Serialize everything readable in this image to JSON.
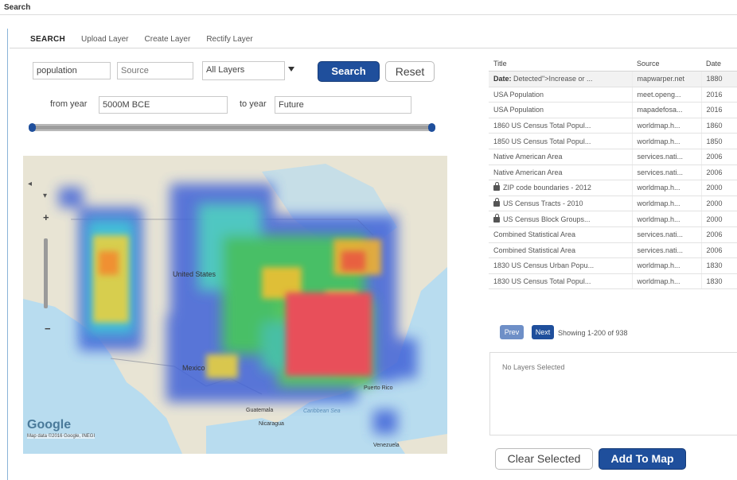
{
  "window": {
    "title": "Search"
  },
  "tabs": [
    {
      "label": "SEARCH",
      "active": true
    },
    {
      "label": "Upload Layer",
      "active": false
    },
    {
      "label": "Create Layer",
      "active": false
    },
    {
      "label": "Rectify Layer",
      "active": false
    }
  ],
  "search": {
    "query_value": "population",
    "source_placeholder": "Source",
    "layers_selected": "All Layers",
    "search_label": "Search",
    "reset_label": "Reset",
    "from_year_label": "from year",
    "from_year_value": "5000M BCE",
    "to_year_label": "to year",
    "to_year_value": "Future"
  },
  "map": {
    "labels": {
      "usa": "United States",
      "mexico": "Mexico",
      "puerto_rico": "Puerto Rico",
      "guatemala": "Guatemala",
      "nicaragua": "Nicaragua",
      "caribbean": "Caribbean Sea",
      "venezuela": "Venezuela"
    },
    "google_logo": "Google",
    "attribution": "Map data ©2016 Google, INEGI"
  },
  "results": {
    "columns": [
      "Title",
      "Source",
      "Date"
    ],
    "rows": [
      {
        "title_prefix": "Date:",
        "title": "Detected\">Increase or ...",
        "source": "mapwarper.net",
        "date": "1880",
        "locked": false
      },
      {
        "title_prefix": "",
        "title": "USA Population",
        "source": "meet.openg...",
        "date": "2016",
        "locked": false
      },
      {
        "title_prefix": "",
        "title": "USA Population",
        "source": "mapadefosa...",
        "date": "2016",
        "locked": false
      },
      {
        "title_prefix": "",
        "title": "1860 US Census Total Popul...",
        "source": "worldmap.h...",
        "date": "1860",
        "locked": false
      },
      {
        "title_prefix": "",
        "title": "1850 US Census Total Popul...",
        "source": "worldmap.h...",
        "date": "1850",
        "locked": false
      },
      {
        "title_prefix": "",
        "title": "Native American Area",
        "source": "services.nati...",
        "date": "2006",
        "locked": false
      },
      {
        "title_prefix": "",
        "title": "Native American Area",
        "source": "services.nati...",
        "date": "2006",
        "locked": false
      },
      {
        "title_prefix": "",
        "title": "ZIP code boundaries - 2012",
        "source": "worldmap.h...",
        "date": "2000",
        "locked": true
      },
      {
        "title_prefix": "",
        "title": "US Census Tracts - 2010",
        "source": "worldmap.h...",
        "date": "2000",
        "locked": true
      },
      {
        "title_prefix": "",
        "title": "US Census Block Groups...",
        "source": "worldmap.h...",
        "date": "2000",
        "locked": true
      },
      {
        "title_prefix": "",
        "title": "Combined Statistical Area",
        "source": "services.nati...",
        "date": "2006",
        "locked": false
      },
      {
        "title_prefix": "",
        "title": "Combined Statistical Area",
        "source": "services.nati...",
        "date": "2006",
        "locked": false
      },
      {
        "title_prefix": "",
        "title": "1830 US Census Urban Popu...",
        "source": "worldmap.h...",
        "date": "1830",
        "locked": false
      },
      {
        "title_prefix": "",
        "title": "1830 US Census Total Popul...",
        "source": "worldmap.h...",
        "date": "1830",
        "locked": false
      }
    ],
    "prev_label": "Prev",
    "next_label": "Next",
    "showing_text": "Showing 1-200 of 938"
  },
  "selection": {
    "empty_text": "No Layers Selected",
    "clear_label": "Clear Selected",
    "add_label": "Add To Map"
  },
  "colors": {
    "primary": "#1f4f9c",
    "frame_border": "#8ab4d8"
  }
}
